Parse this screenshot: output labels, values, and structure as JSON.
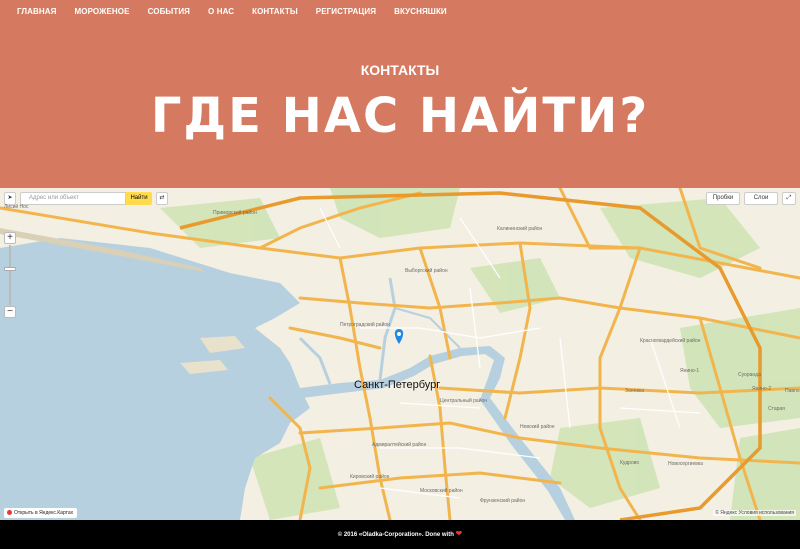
{
  "nav": {
    "items": [
      "ГЛАВНАЯ",
      "МОРОЖЕНОЕ",
      "СОБЫТИЯ",
      "О НАС",
      "КОНТАКТЫ",
      "РЕГИСТРАЦИЯ",
      "ВКУСНЯШКИ"
    ]
  },
  "hero": {
    "kicker": "КОНТАКТЫ",
    "title": "ГДЕ НАС НАЙТИ?"
  },
  "map": {
    "search_placeholder": "Адрес или объект",
    "search_button": "Найти",
    "traffic_label": "Пробки",
    "layers_label": "Слои",
    "city_label": "Санкт-Петербург",
    "open_link": "Открыть в Яндекс.Картах",
    "copyright": "© Яндекс Условия использования",
    "labels": {
      "lisiy_nos": "Лисий Нос",
      "petrogradskiy": "Петроградский район",
      "kalininskiy": "Калининский район",
      "primorskiy": "Приморский район",
      "krasnogvardeyskiy": "Красногвардейский район",
      "vyborgskiy": "Выборгский район",
      "kirovskiy": "Кировский район",
      "frunzenskiy": "Фрунзенский район",
      "kupchino": "Купчино",
      "kudrovo": "Кудрово",
      "novosergievka": "Новосергиевка",
      "yanino1": "Янино-1",
      "yanino2": "Янино-2",
      "zanevka": "Заневка",
      "sorinda": "Суоранда",
      "staraya": "Старая",
      "pavlovo": "Павло",
      "admiralteyskiy": "Адмиралтейский район",
      "moskovskiy": "Московский район",
      "nevskiy": "Невский район",
      "centralniy": "Центральный район"
    }
  },
  "footer": {
    "text": "© 2016 «Oladka-Corporation». Done with",
    "heart": "❤"
  },
  "colors": {
    "header_bg": "#d57a60",
    "water": "#b7d0df",
    "roads": "#f2b54e",
    "land": "#f3efe2",
    "park": "#cfe3b5",
    "pin": "#1e88e5",
    "footer_bg": "#000000"
  }
}
